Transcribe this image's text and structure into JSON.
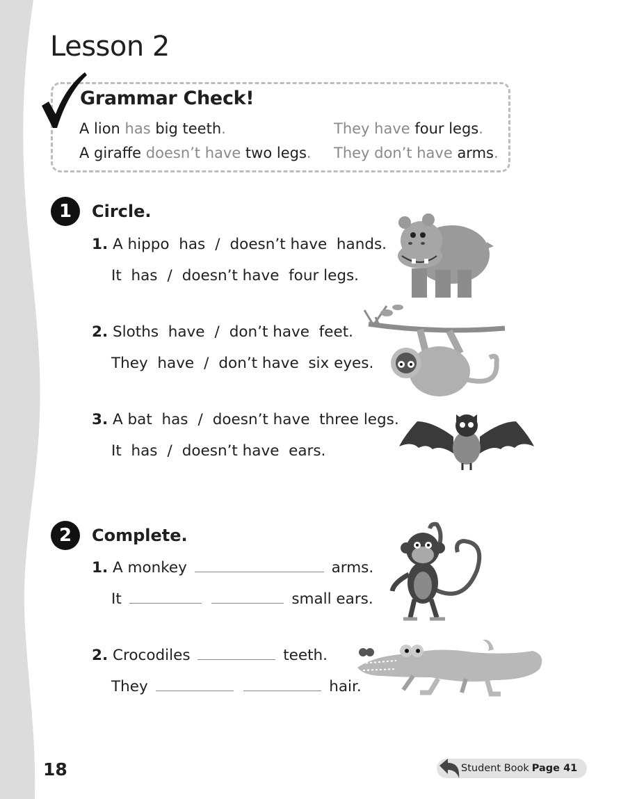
{
  "lesson_title": "Lesson 2",
  "grammar_check": {
    "title": "Grammar Check!",
    "left": [
      {
        "a": "A lion ",
        "hl": "has",
        "b": " big teeth",
        "c": "."
      },
      {
        "a": "A giraffe ",
        "hl": "doesn’t have",
        "b": " two legs",
        "c": "."
      }
    ],
    "right": [
      {
        "a": "",
        "hl": "They have",
        "b": " four legs",
        "c": "."
      },
      {
        "a": "",
        "hl": "They don’t have",
        "b": " arms",
        "c": "."
      }
    ]
  },
  "section1": {
    "number": "1",
    "title": "Circle.",
    "items": [
      {
        "num": "1.",
        "line1": {
          "subject": "A hippo",
          "opt1": "has",
          "slash": "/",
          "opt2": "doesn’t have",
          "object": "hands."
        },
        "line2": {
          "subject": "It",
          "opt1": "has",
          "slash": "/",
          "opt2": "doesn’t have",
          "object": "four legs."
        }
      },
      {
        "num": "2.",
        "line1": {
          "subject": "Sloths",
          "opt1": "have",
          "slash": "/",
          "opt2": "don’t have",
          "object": "feet."
        },
        "line2": {
          "subject": "They",
          "opt1": "have",
          "slash": "/",
          "opt2": "don’t have",
          "object": "six eyes."
        }
      },
      {
        "num": "3.",
        "line1": {
          "subject": "A bat",
          "opt1": "has",
          "slash": "/",
          "opt2": "doesn’t have",
          "object": "three legs."
        },
        "line2": {
          "subject": "It",
          "opt1": "has",
          "slash": "/",
          "opt2": "doesn’t have",
          "object": "ears."
        }
      }
    ]
  },
  "section2": {
    "number": "2",
    "title": "Complete.",
    "items": [
      {
        "num": "1.",
        "line1": {
          "subject": "A monkey",
          "object": "arms."
        },
        "line2": {
          "subject": "It",
          "object": "small ears."
        }
      },
      {
        "num": "2.",
        "line1": {
          "subject": "Crocodiles",
          "object": "teeth."
        },
        "line2": {
          "subject": "They",
          "object": "hair."
        }
      }
    ]
  },
  "page_number": "18",
  "student_book": {
    "label": "Student Book",
    "page": "Page 41"
  },
  "colors": {
    "edge": "#dcdcdc",
    "highlight": "#8a8a8a",
    "badge": "#e2e2e2",
    "ink": "#1f1f1f"
  },
  "icons": [
    "checkmark-icon",
    "hippo-icon",
    "sloth-icon",
    "bat-icon",
    "monkey-icon",
    "crocodile-icon",
    "return-arrow-icon"
  ]
}
